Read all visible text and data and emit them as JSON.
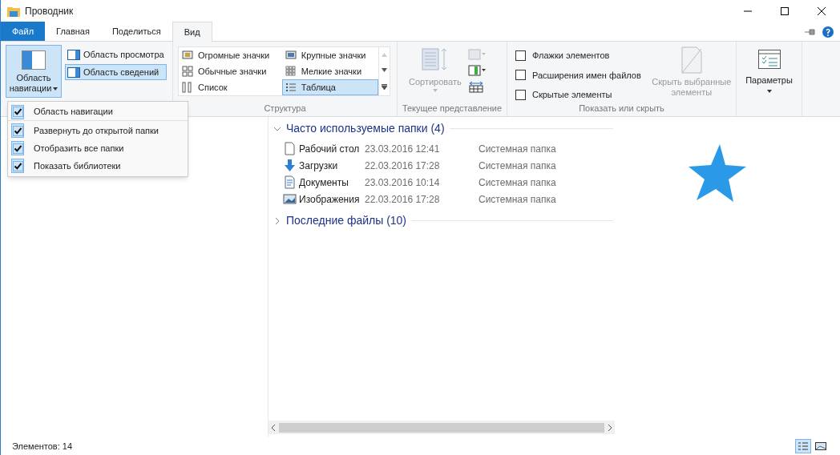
{
  "window": {
    "title": "Проводник"
  },
  "tabs": [
    {
      "label": "Файл",
      "kind": "file",
      "selected": false
    },
    {
      "label": "Главная",
      "kind": "tab",
      "selected": false
    },
    {
      "label": "Поделиться",
      "kind": "tab",
      "selected": false
    },
    {
      "label": "Вид",
      "kind": "tab",
      "selected": true
    }
  ],
  "ribbon": {
    "panes": {
      "nav_button": {
        "label": "Область навигации",
        "selected": true
      },
      "items": [
        {
          "label": "Область просмотра",
          "selected": false
        },
        {
          "label": "Область сведений",
          "selected": true
        }
      ]
    },
    "layout": {
      "label": "Структура",
      "items": [
        {
          "label": "Огромные значки",
          "kind": "huge",
          "selected": false
        },
        {
          "label": "Крупные значки",
          "kind": "large",
          "selected": false
        },
        {
          "label": "Обычные значки",
          "kind": "medium",
          "selected": false
        },
        {
          "label": "Мелкие значки",
          "kind": "small",
          "selected": false
        },
        {
          "label": "Список",
          "kind": "list",
          "selected": false
        },
        {
          "label": "Таблица",
          "kind": "details",
          "selected": true
        }
      ]
    },
    "current_view": {
      "label": "Текущее представление",
      "sort_button": "Сортировать"
    },
    "show_hide": {
      "label": "Показать или скрыть",
      "checkboxes": [
        {
          "label": "Флажки элементов",
          "checked": false
        },
        {
          "label": "Расширения имен файлов",
          "checked": false
        },
        {
          "label": "Скрытые элементы",
          "checked": false
        }
      ],
      "hide_button": "Скрыть выбранные элементы"
    },
    "options_button": "Параметры"
  },
  "nav_menu": [
    {
      "label": "Область навигации",
      "checked": true
    },
    {
      "label": "Развернуть до открытой папки",
      "checked": true
    },
    {
      "label": "Отобразить все папки",
      "checked": true
    },
    {
      "label": "Показать библиотеки",
      "checked": true
    }
  ],
  "sections": [
    {
      "title": "Часто используемые папки (4)",
      "expanded": true,
      "items": [
        {
          "name": "Рабочий стол",
          "date": "23.03.2016 12:41",
          "type": "Системная папка",
          "kind": "desktop"
        },
        {
          "name": "Загрузки",
          "date": "22.03.2016 17:28",
          "type": "Системная папка",
          "kind": "downloads"
        },
        {
          "name": "Документы",
          "date": "23.03.2016 10:14",
          "type": "Системная папка",
          "kind": "documents"
        },
        {
          "name": "Изображения",
          "date": "22.03.2016 17:28",
          "type": "Системная папка",
          "kind": "pictures"
        }
      ]
    },
    {
      "title": "Последние файлы (10)",
      "expanded": false
    }
  ],
  "status_bar": {
    "count": "Элементов: 14",
    "views": [
      {
        "kind": "details",
        "selected": true
      },
      {
        "kind": "large",
        "selected": false
      }
    ]
  }
}
